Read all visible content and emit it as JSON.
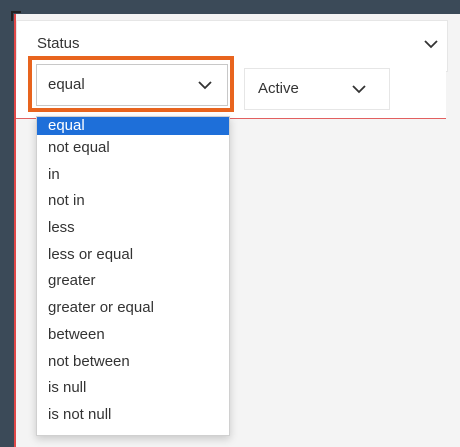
{
  "colors": {
    "frame": "#3b4a58",
    "highlight": "#e8641e",
    "selected_bg": "#1e6fd9",
    "selected_text": "#ffffff",
    "accent_line": "#e26060"
  },
  "field": {
    "label": "Status",
    "chevron_icon": "chevron-down-icon"
  },
  "operator": {
    "selected": "equal",
    "chevron_icon": "chevron-down-icon",
    "options": [
      "equal",
      "not equal",
      "in",
      "not in",
      "less",
      "less or equal",
      "greater",
      "greater or equal",
      "between",
      "not between",
      "is null",
      "is not null"
    ]
  },
  "value": {
    "selected": "Active",
    "chevron_icon": "chevron-down-icon"
  }
}
